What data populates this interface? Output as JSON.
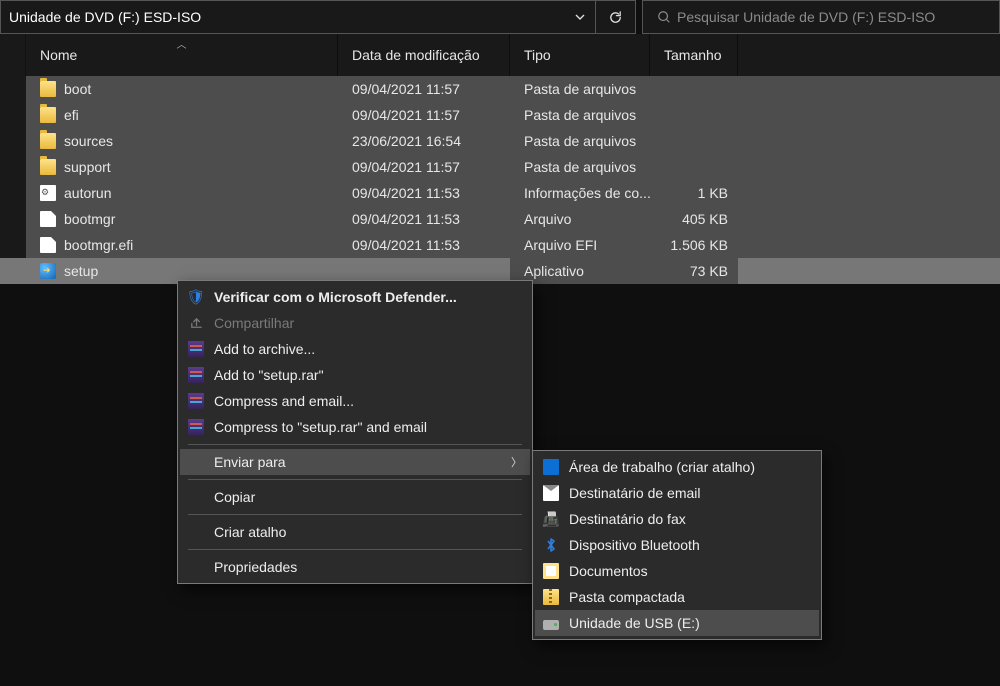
{
  "address_bar": {
    "path": "Unidade de DVD (F:) ESD-ISO",
    "search_placeholder": "Pesquisar Unidade de DVD (F:) ESD-ISO"
  },
  "columns": {
    "name": "Nome",
    "date": "Data de modificação",
    "type": "Tipo",
    "size": "Tamanho"
  },
  "rows": [
    {
      "icon": "folder",
      "name": "boot",
      "date": "09/04/2021 11:57",
      "type": "Pasta de arquivos",
      "size": "",
      "state": "sel"
    },
    {
      "icon": "folder",
      "name": "efi",
      "date": "09/04/2021 11:57",
      "type": "Pasta de arquivos",
      "size": "",
      "state": "sel"
    },
    {
      "icon": "folder",
      "name": "sources",
      "date": "23/06/2021 16:54",
      "type": "Pasta de arquivos",
      "size": "",
      "state": "sel"
    },
    {
      "icon": "folder",
      "name": "support",
      "date": "09/04/2021 11:57",
      "type": "Pasta de arquivos",
      "size": "",
      "state": "sel"
    },
    {
      "icon": "cfg",
      "name": "autorun",
      "date": "09/04/2021 11:53",
      "type": "Informações de co...",
      "size": "1 KB",
      "state": "sel"
    },
    {
      "icon": "file",
      "name": "bootmgr",
      "date": "09/04/2021 11:53",
      "type": "Arquivo",
      "size": "405 KB",
      "state": "sel"
    },
    {
      "icon": "file",
      "name": "bootmgr.efi",
      "date": "09/04/2021 11:53",
      "type": "Arquivo EFI",
      "size": "1.506 KB",
      "state": "sel"
    },
    {
      "icon": "exe",
      "name": "setup",
      "date": "",
      "type": "",
      "size": "73 KB",
      "state": "selactive",
      "type2": "Aplicativo"
    }
  ],
  "context_menu": {
    "defender": "Verificar com o Microsoft Defender...",
    "share": "Compartilhar",
    "add_archive": "Add to archive...",
    "add_setup_rar": "Add to \"setup.rar\"",
    "compress_email": "Compress and email...",
    "compress_setup": "Compress to \"setup.rar\" and email",
    "send_to": "Enviar para",
    "copy": "Copiar",
    "shortcut": "Criar atalho",
    "properties": "Propriedades"
  },
  "send_to_menu": {
    "desktop": "Área de trabalho (criar atalho)",
    "mail": "Destinatário de email",
    "fax": "Destinatário do fax",
    "bluetooth": "Dispositivo Bluetooth",
    "docs": "Documentos",
    "zip": "Pasta compactada",
    "usb": "Unidade de USB (E:)"
  }
}
